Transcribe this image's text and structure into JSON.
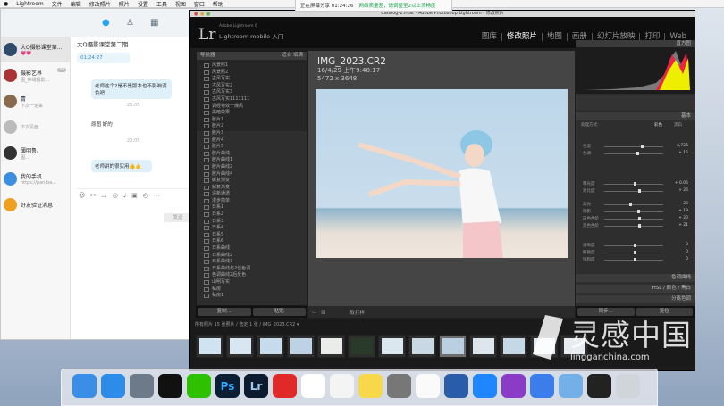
{
  "menubar": {
    "items": [
      "Lightroom",
      "文件",
      "编辑",
      "修改照片",
      "照片",
      "设置",
      "工具",
      "视图",
      "窗口",
      "帮助"
    ]
  },
  "recording": {
    "label": "正在屏幕分享 01:24:26",
    "status": "网络质量差，请调整至2以上流畅度"
  },
  "qq": {
    "contacts": [
      {
        "name": "大Q摄影课堂第...",
        "sub": "💗💗 ...",
        "color": "#2f4a6a",
        "sel": true
      },
      {
        "name": "摄影艺界",
        "sub": "图_神域摄影...",
        "color": "#a33",
        "badge": "99"
      },
      {
        "name": "青",
        "sub": "下次一定来",
        "color": "#8a6a4f"
      },
      {
        "name": "",
        "sub": "下次见面",
        "color": "#bbb"
      },
      {
        "name": "薄明鲁。",
        "sub": "图...",
        "color": "#333"
      },
      {
        "name": "我的手机",
        "sub": "https://pan.ba...",
        "color": "#3c8fe0"
      },
      {
        "name": "好友验证消息",
        "sub": "",
        "color": "#f0a020"
      }
    ],
    "chat_title": "大Q摄影课堂第二期",
    "messages": [
      {
        "text": "01:24:27",
        "kind": "file"
      },
      {
        "text": "老师这个2是不是版本也不影响调色吧",
        "kind": "bubble"
      },
      {
        "text": "20:05",
        "kind": "time"
      },
      {
        "text": "原图 好的",
        "kind": "plain"
      },
      {
        "text": "20:05",
        "kind": "time"
      },
      {
        "text": "老师讲的很实用👍👍",
        "kind": "bubble"
      }
    ],
    "send_label": "发送"
  },
  "lr": {
    "window_title": "Catalog-2.lrcat - Adobe Photoshop Lightroom - 修改照片",
    "logo": "Lr",
    "app_small": "Adobe Lightroom 6",
    "app_name": "Lightroom mobile 入门",
    "modules": [
      "图库",
      "修改照片",
      "地图",
      "画册",
      "幻灯片放映",
      "打印",
      "Web"
    ],
    "active_module": "修改照片",
    "left_panel_title": "导航器",
    "left_panel_mode": "适合 填满",
    "presets": [
      "风景照1",
      "风景照2",
      "古风写实",
      "古风写实2",
      "古风写实3",
      "古风写实1111111",
      "调经特效干燥风",
      "黑暗效果",
      "胶片1",
      "胶片2",
      "胶片3",
      "胶片4",
      "胶片5",
      "胶片曲线",
      "胶片曲线1",
      "胶片曲线2",
      "胶片曲线4",
      "解复渐变",
      "解复渐变",
      "清新通透",
      "漫步简单",
      "日系1",
      "日系2",
      "日系3",
      "日系4",
      "日系5",
      "日系6",
      "日系曲线",
      "日系曲线2",
      "日系曲线3",
      "日系曲线与2位色调",
      "色调曲线2后反色",
      "山明写实",
      "私房",
      "私房1"
    ],
    "copy_btn": "复制...",
    "paste_btn": "粘贴",
    "photo": {
      "name": "IMG_2023.CR2",
      "date": "16/4/29 上午9:48:17",
      "dims": "5472 x 3648"
    },
    "toolbar": {
      "label": "软打样"
    },
    "right": {
      "histogram": "直方图",
      "basic": "基本",
      "treatment": "处理方式：",
      "color": "彩色",
      "bw": "黑白",
      "profile": "自定",
      "wb_label": "色温",
      "tint": "色调",
      "sliders": [
        {
          "label": "色温",
          "val": "4,726"
        },
        {
          "label": "色调",
          "val": "+ 15"
        },
        {
          "label": "曝光度",
          "val": "+ 0.05"
        },
        {
          "label": "对比度",
          "val": "+ 26"
        },
        {
          "label": "高光",
          "val": "- 23"
        },
        {
          "label": "阴影",
          "val": "+ 19"
        },
        {
          "label": "白色色阶",
          "val": "+ 20"
        },
        {
          "label": "黑色色阶",
          "val": "+ 21"
        },
        {
          "label": "清晰度",
          "val": "0"
        },
        {
          "label": "鲜艳度",
          "val": "0"
        },
        {
          "label": "饱和度",
          "val": "0"
        }
      ],
      "tone_curve": "色调曲线",
      "hsl": "HSL / 颜色 / 黑白",
      "split": "分离色调",
      "sync": "同步...",
      "reset": "复位"
    },
    "filmbar": "所有照片  15 张照片 / 选定 1 张 / IMG_2023.CR2 ▾"
  },
  "dock": [
    "finder",
    "safari",
    "launchpad",
    "qq",
    "wechat",
    "Ps",
    "Lr",
    "netease",
    "calendar",
    "notes",
    "stickies",
    "settings",
    "photos",
    "screen",
    "feishu",
    "video",
    "baidu",
    "folder",
    "terminal",
    "trash"
  ],
  "watermark": {
    "big": "灵感中国",
    "small": "lingganchina.com"
  }
}
